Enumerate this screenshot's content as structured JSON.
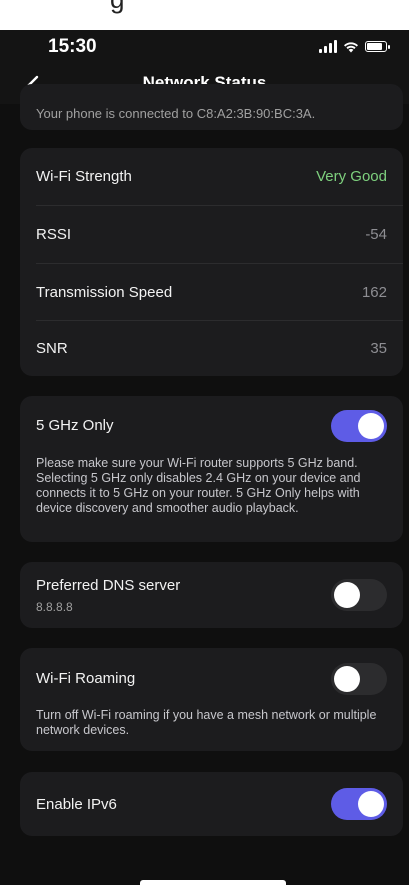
{
  "top_clip_text": "g",
  "status_bar": {
    "time": "15:30"
  },
  "nav": {
    "title": "Network Status",
    "back_icon": "chevron-left-icon"
  },
  "connection": {
    "text": "Your phone is connected to C8:A2:3B:90:BC:3A."
  },
  "wifi_stats": [
    {
      "label": "Wi-Fi Strength",
      "value": "Very Good"
    },
    {
      "label": "RSSI",
      "value": "-54"
    },
    {
      "label": "Transmission Speed",
      "value": "162"
    },
    {
      "label": "SNR",
      "value": "35"
    }
  ],
  "five_ghz": {
    "title": "5 GHz Only",
    "enabled": true,
    "description": "Please make sure your Wi-Fi router supports 5 GHz band. Selecting 5 GHz only disables 2.4 GHz on your device and connects it to 5 GHz on your router. 5 GHz Only helps with device discovery and smoother audio playback."
  },
  "dns": {
    "title": "Preferred DNS server",
    "subtitle": "8.8.8.8",
    "enabled": false
  },
  "roaming": {
    "title": "Wi-Fi Roaming",
    "enabled": false,
    "description": "Turn off Wi-Fi roaming if you have a mesh network or multiple network devices."
  },
  "ipv6": {
    "title": "Enable IPv6",
    "enabled": true
  },
  "colors": {
    "accent": "#5e5ce6",
    "good": "#7ed07e",
    "card": "#1c1c1e",
    "background": "#0f0f0f"
  }
}
